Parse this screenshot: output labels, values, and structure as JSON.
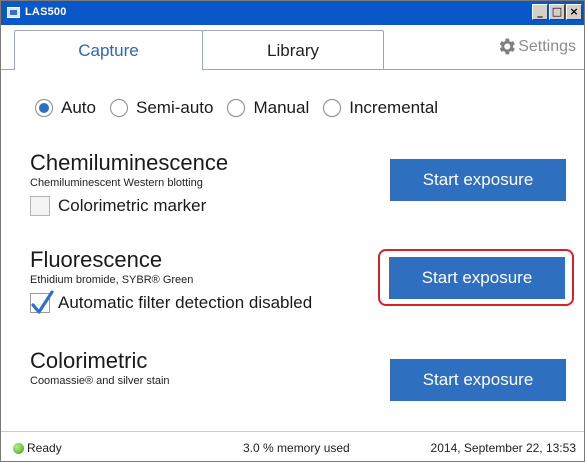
{
  "window": {
    "title": "LAS500",
    "min": "_",
    "max": "□",
    "close": "×"
  },
  "tabs": [
    {
      "label": "Capture",
      "active": true
    },
    {
      "label": "Library",
      "active": false
    }
  ],
  "settings": {
    "label": "Settings",
    "icon": "gear-icon"
  },
  "modes": [
    {
      "label": "Auto",
      "checked": true
    },
    {
      "label": "Semi-auto",
      "checked": false
    },
    {
      "label": "Manual",
      "checked": false
    },
    {
      "label": "Incremental",
      "checked": false
    }
  ],
  "sections": [
    {
      "title": "Chemiluminescence",
      "subtitle": "Chemiluminescent Western blotting",
      "option": {
        "label": "Colorimetric marker",
        "checked": false
      },
      "button": "Start exposure"
    },
    {
      "title": "Fluorescence",
      "subtitle": "Ethidium bromide, SYBR® Green",
      "option": {
        "label": "Automatic filter detection disabled",
        "checked": true
      },
      "button": "Start exposure",
      "highlighted": true
    },
    {
      "title": "Colorimetric",
      "subtitle": "Coomassie® and silver stain",
      "button": "Start exposure"
    }
  ],
  "status": {
    "state": "Ready",
    "memory": "3.0 % memory used",
    "datetime": "2014, September 22, 13:53"
  },
  "colors": {
    "accent": "#2f6fbf",
    "highlight": "#d8202a",
    "titlebar": "#0a58c8",
    "ready": "#3aa01c"
  }
}
